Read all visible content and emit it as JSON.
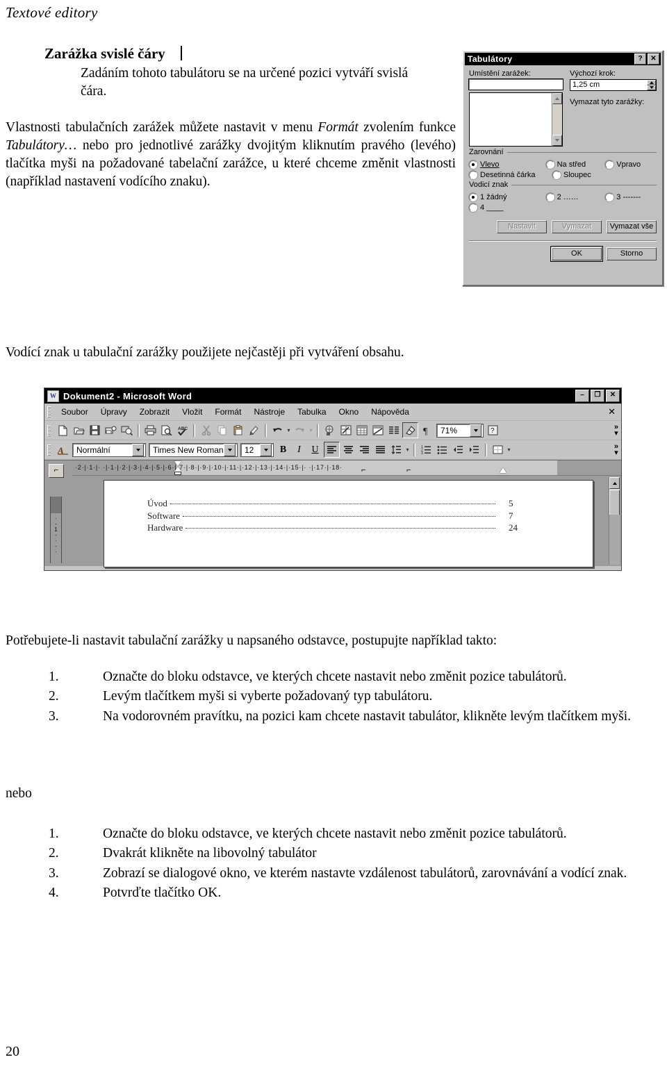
{
  "page": {
    "running_header": "Textové editory",
    "page_number": "20"
  },
  "section": {
    "heading": "Zarážka svislé čáry",
    "heading_marker_icon": "vertical-bar-icon",
    "heading_paragraph": "Zadáním tohoto tabulátoru se na určené pozici vytváří svislá čára.",
    "paragraph_parts": {
      "p1": "Vlastnosti tabulačních zarážek můžete nastavit v menu ",
      "p1_italic": "Formát",
      "p2": " zvolením funkce ",
      "p2_italic": "Tabulátory…",
      "p3": " nebo pro jednotlivé zarážky dvojitým kliknutím pravého (levého) tlačítka myši na požadované tabelační zarážce, u které chceme změnit vlastnosti (například nastavení vodícího znaku)."
    },
    "note_vodici": "Vodící znak u tabulační zarážky použijete nejčastěji při vytváření obsahu.",
    "intro_steps": "Potřebujete-li nastavit tabulační zarážky u napsaného odstavce, postupujte například takto:",
    "nebo_label": "nebo"
  },
  "list_a": [
    {
      "num": "1.",
      "text": "Označte do bloku odstavce, ve kterých chcete nastavit nebo změnit pozice tabulátorů."
    },
    {
      "num": "2.",
      "text": "Levým tlačítkem myši si vyberte požadovaný typ tabulátoru."
    },
    {
      "num": "3.",
      "text": "Na vodorovném pravítku, na pozici kam chcete nastavit tabulátor, klikněte levým tlačítkem myši."
    }
  ],
  "list_b": [
    {
      "num": "1.",
      "text": "Označte do bloku odstavce, ve kterých chcete nastavit nebo změnit pozice tabulátorů."
    },
    {
      "num": "2.",
      "text": "Dvakrát klikněte na libovolný tabulátor"
    },
    {
      "num": "3.",
      "text": "Zobrazí se dialogové okno, ve kterém nastavte vzdálenost tabulátorů, zarovnávání a vodící znak."
    },
    {
      "num": "4.",
      "text": "Potvrďte tlačítko OK."
    }
  ],
  "dialog": {
    "title": "Tabulátory",
    "help_button": "?",
    "close_button": "✕",
    "labels": {
      "tab_position": "Umístění zarážek:",
      "default_step": "Výchozí krok:",
      "clear_these": "Vymazat tyto zarážky:",
      "alignment_group": "Zarovnání",
      "leader_group": "Vodicí znak"
    },
    "tab_position_value": "",
    "default_step_value": "1,25 cm",
    "alignment_options": [
      {
        "label": "Vlevo",
        "selected": true
      },
      {
        "label": "Na střed",
        "selected": false
      },
      {
        "label": "Vpravo",
        "selected": false
      },
      {
        "label": "Desetinná čárka",
        "selected": false
      },
      {
        "label": "Sloupec",
        "selected": false
      }
    ],
    "leader_options": [
      {
        "label": "1 žádný",
        "selected": true
      },
      {
        "label": "2 ……",
        "selected": false
      },
      {
        "label": "3 -------",
        "selected": false
      },
      {
        "label": "4 ____",
        "selected": false
      }
    ],
    "buttons": {
      "set": "Nastavit",
      "clear": "Vymazat",
      "clear_all": "Vymazat vše",
      "ok": "OK",
      "cancel": "Storno"
    }
  },
  "word_window": {
    "title": "Dokument2 - Microsoft Word",
    "logo_icon": "word-document-icon",
    "window_buttons": {
      "minimize": "–",
      "restore": "❐",
      "close": "✕"
    },
    "menu": [
      "Soubor",
      "Úpravy",
      "Zobrazit",
      "Vložit",
      "Formát",
      "Nástroje",
      "Tabulka",
      "Okno",
      "Nápověda"
    ],
    "close_document": "✕",
    "standard_toolbar_icons": [
      "new-document-icon",
      "open-folder-icon",
      "save-disk-icon",
      "email-icon",
      "print-preview-search-icon",
      "print-icon",
      "print-preview-icon",
      "spelling-check-icon",
      "cut-scissors-icon",
      "copy-icon",
      "paste-clipboard-icon",
      "format-painter-icon",
      "undo-arrow-icon",
      "undo-dropdown-icon",
      "redo-arrow-icon",
      "redo-dropdown-icon",
      "insert-hyperlink-icon",
      "tables-and-borders-icon",
      "insert-table-icon",
      "insert-excel-sheet-icon",
      "columns-icon",
      "drawing-icon",
      "show-formatting-marks-icon"
    ],
    "zoom_value": "71%",
    "zoom_dropdown_icon": "chevron-down-icon",
    "help_icon": "help-question-icon",
    "overflow_icon": "toolbar-overflow-icon",
    "formatting_toolbar": {
      "style_icon": "style-icon",
      "style_value": "Normální",
      "font_value": "Times New Roman",
      "size_value": "12",
      "bold": "B",
      "italic": "I",
      "underline": "U",
      "align_icons": [
        "align-left-icon",
        "align-center-icon",
        "align-right-icon",
        "justify-icon"
      ],
      "line_spacing_icon": "line-spacing-icon",
      "numbered_list_icon": "numbered-list-icon",
      "bulleted_list_icon": "bulleted-list-icon",
      "decrease_indent_icon": "decrease-indent-icon",
      "increase_indent_icon": "increase-indent-icon",
      "borders_icon": "borders-icon"
    },
    "tab_selector_icon": "left-tab-stop-icon",
    "ruler": {
      "horizontal_labels": "·2·|·1·|·  ·|·1·|·2·|·3·|·4·|·5·|·6·|·7·|·8·|·9·|·10·|·11·|·12·|·13·|·14·|·15·|·  ·|·17·|·18·",
      "vertical_label": "1",
      "tab_stop_markers": [
        "right-tab-stop",
        "right-tab-stop",
        "indent-triangle"
      ]
    },
    "document": {
      "toc_rows": [
        {
          "name": "Úvod",
          "page": "5"
        },
        {
          "name": "Software",
          "page": "7"
        },
        {
          "name": "Hardware",
          "page": "24"
        }
      ]
    },
    "scrollbar_icon": "vertical-scrollbar"
  }
}
